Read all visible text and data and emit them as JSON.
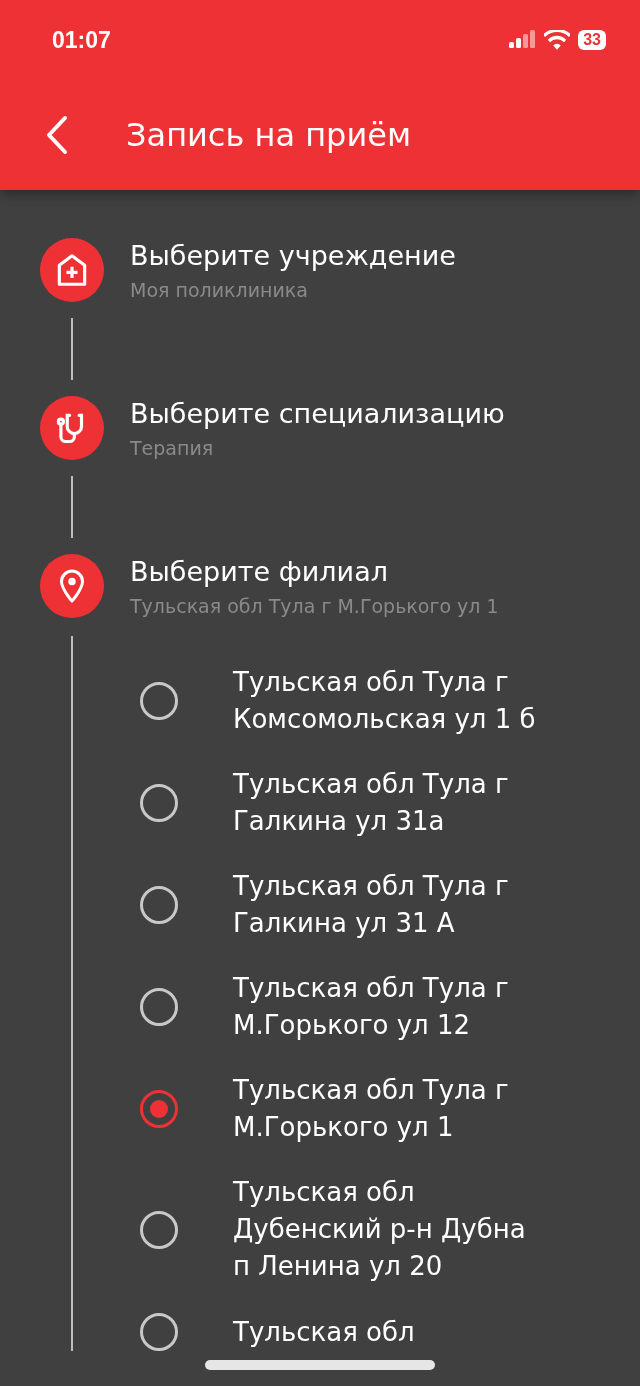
{
  "status_bar": {
    "time": "01:07",
    "battery": "33"
  },
  "header": {
    "title": "Запись на приём"
  },
  "steps": [
    {
      "kind": "clinic",
      "title": "Выберите учреждение",
      "value": "Моя поликлиника"
    },
    {
      "kind": "specialty",
      "title": "Выберите специализацию",
      "value": "Терапия"
    },
    {
      "kind": "branch",
      "title": "Выберите филиал",
      "value": "Тульская обл Тула г М.Горького ул 1"
    }
  ],
  "branches": [
    {
      "label": "Тульская обл Тула г Комсомольская ул 1 б",
      "selected": false
    },
    {
      "label": "Тульская обл Тула г Галкина ул 31а",
      "selected": false
    },
    {
      "label": "Тульская обл Тула г Галкина ул 31 А",
      "selected": false
    },
    {
      "label": "Тульская обл Тула г М.Горького ул 12",
      "selected": false
    },
    {
      "label": "Тульская обл Тула г М.Горького ул 1",
      "selected": true
    },
    {
      "label": "Тульская обл Дубенский р-н Дубна п Ленина ул 20",
      "selected": false
    },
    {
      "label": "Тульская обл",
      "selected": false
    }
  ]
}
